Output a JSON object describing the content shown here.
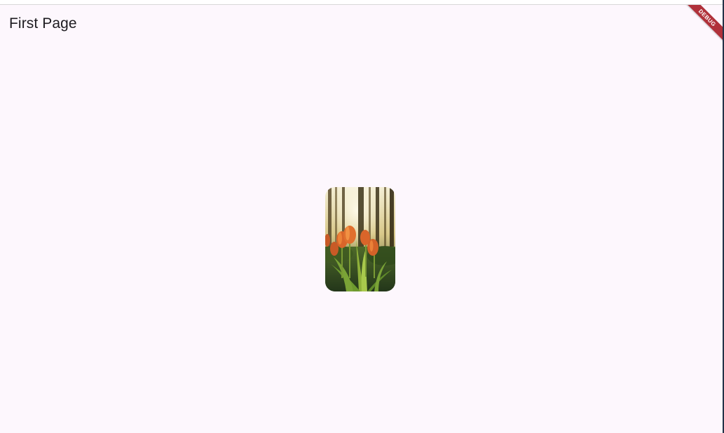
{
  "app_bar": {
    "title": "First Page"
  },
  "debug_banner": {
    "label": "DEBUG",
    "color": "#b0313a"
  },
  "content": {
    "image": {
      "subject": "orange tulips in a sunlit forest",
      "icon": "photo"
    }
  },
  "colors": {
    "background": "#fdf7fd",
    "title_text": "#1d1b20"
  }
}
